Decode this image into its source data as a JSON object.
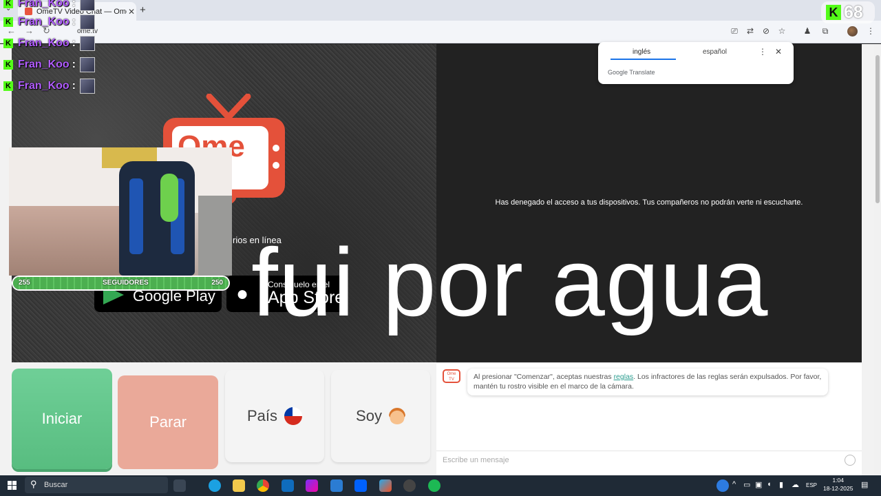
{
  "browser": {
    "tab_title": "OmeTV Video Chat — Omegle",
    "url": "ome.tv",
    "new_tab": "+",
    "close": "✕"
  },
  "translate_popup": {
    "lang_from": "inglés",
    "lang_to": "español",
    "brand": "Google Translate"
  },
  "stream_overlay": {
    "chat": [
      {
        "user": "Fran_Koo",
        "sep": ":"
      },
      {
        "user": "Fran_Koo",
        "sep": ":"
      },
      {
        "user": "Fran_Koo",
        "sep": ":"
      },
      {
        "user": "Fran_Koo",
        "sep": ":"
      },
      {
        "user": "Fran_Koo",
        "sep": ":"
      }
    ],
    "viewers": "68",
    "kick_letter": "K",
    "followers": {
      "current": "255",
      "label": "SEGUIDORES",
      "goal": "250",
      "progress": 1.0
    },
    "caption": "fui por agua"
  },
  "ometv": {
    "logo_text": "Ome",
    "users_online": "rios en línea",
    "google_play": "Google Play",
    "app_store_small": "Consíguelo en el",
    "app_store_big": "App Store",
    "denied_message": "Has denegado el acceso a tus dispositivos. Tus compañeros no podrán verte ni escucharte.",
    "buttons": {
      "start": "Iniciar",
      "stop": "Parar",
      "country": "País",
      "gender": "Soy"
    },
    "chat": {
      "logo": "Ome TV",
      "rules_before": "Al presionar \"Comenzar\", aceptas nuestras ",
      "rules_link": "reglas",
      "rules_after": ". Los infractores de las reglas serán expulsados. Por favor, mantén tu rostro visible en el marco de la cámara.",
      "placeholder": "Escribe un mensaje"
    }
  },
  "taskbar": {
    "search": "Buscar",
    "lang": "ESP",
    "time": "1:04",
    "date": "18-12-2025"
  },
  "colors": {
    "ome_red": "#e4513a",
    "start_green": "#6fcf97",
    "stop_salmon": "#eaa999",
    "kick_green": "#53fc18",
    "chat_name": "#b15cff"
  }
}
